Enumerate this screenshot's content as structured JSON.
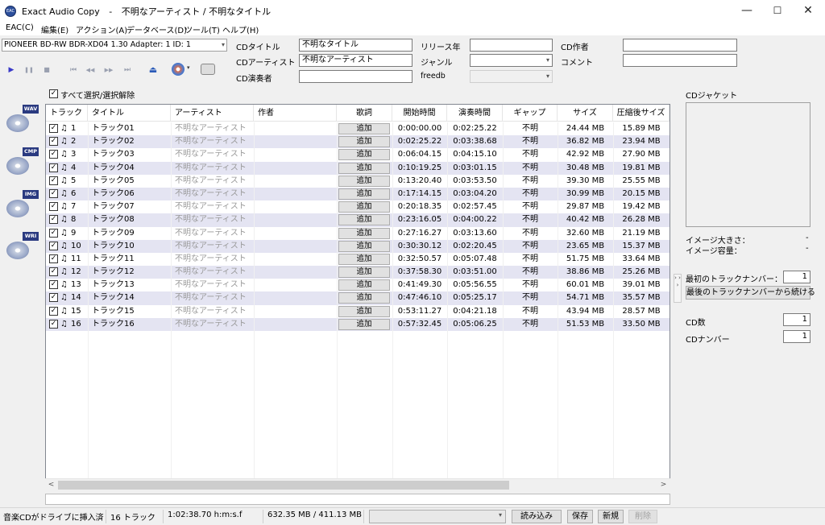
{
  "window": {
    "app_name": "Exact Audio Copy",
    "separator": "-",
    "doc_title": "不明なアーティスト / 不明なタイトル",
    "minimize": "—",
    "maximize": "☐",
    "close": "✕",
    "icon_text": "EAC"
  },
  "menu": [
    "EAC(C)",
    "編集(E)",
    "アクション(A)",
    "データベース(D)",
    "ツール(T)",
    "ヘルプ(H)"
  ],
  "drive": {
    "selected": "PIONEER BD-RW   BDR-XD04 1.30   Adapter: 1  ID: 1"
  },
  "transport": {
    "play": "▶",
    "pause": "❚❚",
    "stop": "■",
    "first": "⏮",
    "prev": "◀◀",
    "next": "▶▶",
    "last": "⏭",
    "eject": "⏏",
    "dropdown": "▾"
  },
  "cd_info": {
    "title_label": "CDタイトル",
    "title_value": "不明なタイトル",
    "artist_label": "CDアーティスト",
    "artist_value": "不明なアーティスト",
    "performer_label": "CD演奏者",
    "performer_value": "",
    "year_label": "リリース年",
    "year_value": "",
    "genre_label": "ジャンル",
    "genre_value": "",
    "freedb_label": "freedb",
    "freedb_value": "",
    "composer_label": "CD作者",
    "composer_value": "",
    "comment_label": "コメント",
    "comment_value": ""
  },
  "select_all": {
    "label": "すべて選択/選択解除",
    "checked": "✓"
  },
  "side_icons": {
    "wav": "WAV",
    "cmp": "CMP",
    "img": "IMG",
    "wri": "WRI"
  },
  "table": {
    "headers": {
      "track": "トラック",
      "title": "タイトル",
      "artist": "アーティスト",
      "composer": "作者",
      "lyrics": "歌詞",
      "start": "開始時間",
      "length": "演奏時間",
      "gap": "ギャップ",
      "size": "サイズ",
      "csize": "圧縮後サイズ"
    },
    "add_label": "追加",
    "check": "✓",
    "note": "♫",
    "rows": [
      {
        "num": "1",
        "title": "トラック01",
        "artist": "不明なアーティスト",
        "start": "0:00:00.00",
        "length": "0:02:25.22",
        "gap": "不明",
        "size": "24.44 MB",
        "csize": "15.89 MB"
      },
      {
        "num": "2",
        "title": "トラック02",
        "artist": "不明なアーティスト",
        "start": "0:02:25.22",
        "length": "0:03:38.68",
        "gap": "不明",
        "size": "36.82 MB",
        "csize": "23.94 MB"
      },
      {
        "num": "3",
        "title": "トラック03",
        "artist": "不明なアーティスト",
        "start": "0:06:04.15",
        "length": "0:04:15.10",
        "gap": "不明",
        "size": "42.92 MB",
        "csize": "27.90 MB"
      },
      {
        "num": "4",
        "title": "トラック04",
        "artist": "不明なアーティスト",
        "start": "0:10:19.25",
        "length": "0:03:01.15",
        "gap": "不明",
        "size": "30.48 MB",
        "csize": "19.81 MB"
      },
      {
        "num": "5",
        "title": "トラック05",
        "artist": "不明なアーティスト",
        "start": "0:13:20.40",
        "length": "0:03:53.50",
        "gap": "不明",
        "size": "39.30 MB",
        "csize": "25.55 MB"
      },
      {
        "num": "6",
        "title": "トラック06",
        "artist": "不明なアーティスト",
        "start": "0:17:14.15",
        "length": "0:03:04.20",
        "gap": "不明",
        "size": "30.99 MB",
        "csize": "20.15 MB"
      },
      {
        "num": "7",
        "title": "トラック07",
        "artist": "不明なアーティスト",
        "start": "0:20:18.35",
        "length": "0:02:57.45",
        "gap": "不明",
        "size": "29.87 MB",
        "csize": "19.42 MB"
      },
      {
        "num": "8",
        "title": "トラック08",
        "artist": "不明なアーティスト",
        "start": "0:23:16.05",
        "length": "0:04:00.22",
        "gap": "不明",
        "size": "40.42 MB",
        "csize": "26.28 MB"
      },
      {
        "num": "9",
        "title": "トラック09",
        "artist": "不明なアーティスト",
        "start": "0:27:16.27",
        "length": "0:03:13.60",
        "gap": "不明",
        "size": "32.60 MB",
        "csize": "21.19 MB"
      },
      {
        "num": "10",
        "title": "トラック10",
        "artist": "不明なアーティスト",
        "start": "0:30:30.12",
        "length": "0:02:20.45",
        "gap": "不明",
        "size": "23.65 MB",
        "csize": "15.37 MB"
      },
      {
        "num": "11",
        "title": "トラック11",
        "artist": "不明なアーティスト",
        "start": "0:32:50.57",
        "length": "0:05:07.48",
        "gap": "不明",
        "size": "51.75 MB",
        "csize": "33.64 MB"
      },
      {
        "num": "12",
        "title": "トラック12",
        "artist": "不明なアーティスト",
        "start": "0:37:58.30",
        "length": "0:03:51.00",
        "gap": "不明",
        "size": "38.86 MB",
        "csize": "25.26 MB"
      },
      {
        "num": "13",
        "title": "トラック13",
        "artist": "不明なアーティスト",
        "start": "0:41:49.30",
        "length": "0:05:56.55",
        "gap": "不明",
        "size": "60.01 MB",
        "csize": "39.01 MB"
      },
      {
        "num": "14",
        "title": "トラック14",
        "artist": "不明なアーティスト",
        "start": "0:47:46.10",
        "length": "0:05:25.17",
        "gap": "不明",
        "size": "54.71 MB",
        "csize": "35.57 MB"
      },
      {
        "num": "15",
        "title": "トラック15",
        "artist": "不明なアーティスト",
        "start": "0:53:11.27",
        "length": "0:04:21.18",
        "gap": "不明",
        "size": "43.94 MB",
        "csize": "28.57 MB"
      },
      {
        "num": "16",
        "title": "トラック16",
        "artist": "不明なアーティスト",
        "start": "0:57:32.45",
        "length": "0:05:06.25",
        "gap": "不明",
        "size": "51.53 MB",
        "csize": "33.50 MB"
      }
    ]
  },
  "scroll": {
    "left": "<",
    "right": ">"
  },
  "right_panel": {
    "cover_label": "CDジャケット",
    "image_size_label": "イメージ大きさ：",
    "image_size_value": "-",
    "image_capacity_label": "イメージ容量：",
    "image_capacity_value": "-",
    "first_track_label": "最初のトラックナンバー：",
    "first_track_value": "1",
    "continue_button": "最後のトラックナンバーから続ける",
    "cd_count_label": "CD数",
    "cd_count_value": "1",
    "cd_number_label": "CDナンバー",
    "cd_number_value": "1",
    "collapse": "› › ›"
  },
  "status": {
    "state": "音楽CDがドライブに挿入済",
    "tracks": "16 トラック",
    "duration": "1:02:38.70 h:m:s.f",
    "size": "632.35 MB / 411.13 MB",
    "load": "読み込み",
    "save": "保存",
    "new": "新規",
    "delete": "削除"
  }
}
